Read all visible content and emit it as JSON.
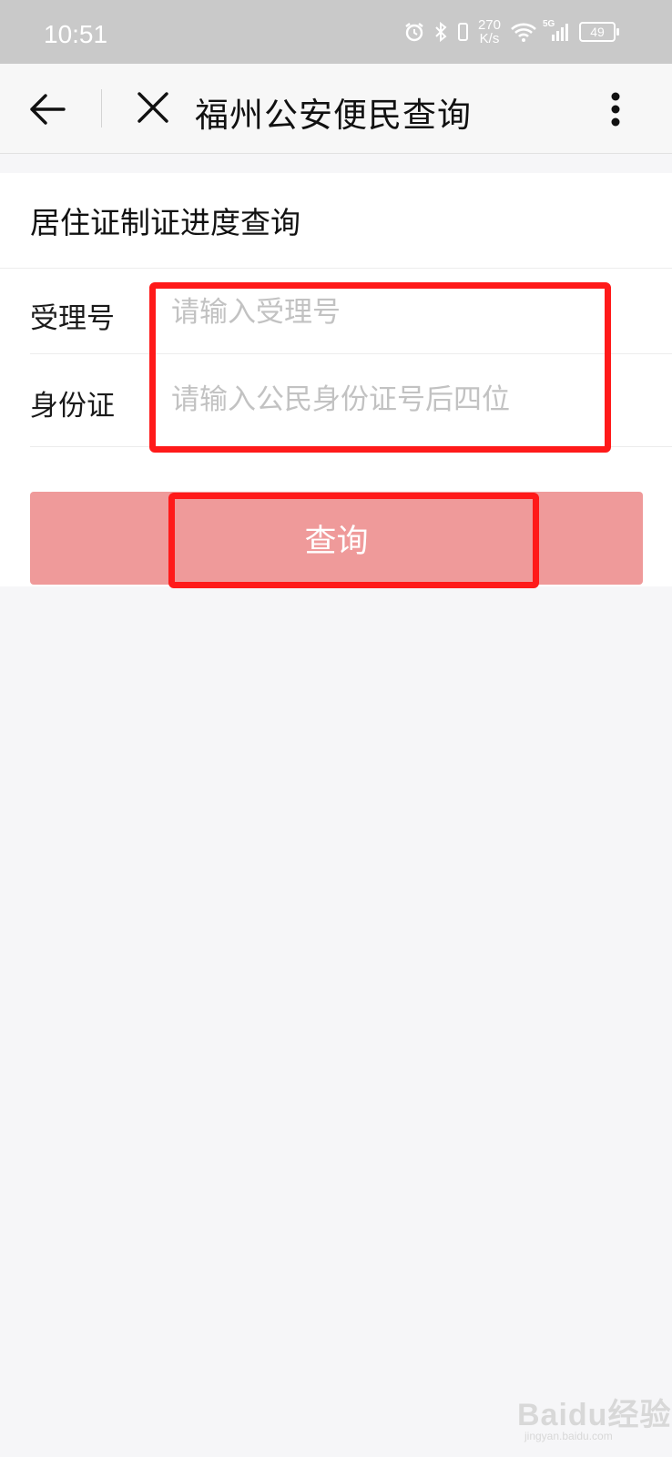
{
  "status_bar": {
    "time": "10:51",
    "speed_value": "270",
    "speed_unit": "K/s",
    "network": "5G",
    "battery": "49",
    "icons": [
      "alarm-icon",
      "bluetooth-icon",
      "vibrate-icon",
      "wifi-icon",
      "signal-icon",
      "battery-icon"
    ]
  },
  "nav": {
    "title": "福州公安便民查询",
    "icons": [
      "back-arrow-icon",
      "close-icon",
      "more-icon"
    ]
  },
  "form": {
    "title": "居住证制证进度查询",
    "fields": [
      {
        "label": "受理号",
        "placeholder": "请输入受理号",
        "value": ""
      },
      {
        "label": "身份证",
        "placeholder": "请输入公民身份证号后四位",
        "value": ""
      }
    ],
    "submit_label": "查询"
  },
  "watermark": {
    "logo_text": "Baidu经验",
    "url": "jingyan.baidu.com"
  },
  "colors": {
    "status_bar": "#c9c9c9",
    "button": "#ef9a9a",
    "highlight": "#ff1a1a",
    "background": "#f6f6f8"
  }
}
